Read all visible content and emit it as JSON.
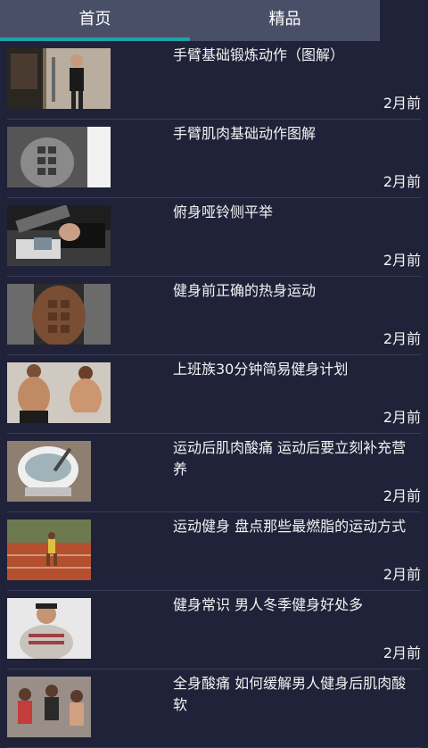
{
  "tabs": [
    {
      "label": "首页",
      "selected": true
    },
    {
      "label": "精品",
      "selected": false
    }
  ],
  "colors": {
    "background": "#1f2238",
    "tabbar": "#4a4f68",
    "indicator": "#1ea3a8"
  },
  "articles": [
    {
      "title": "手臂基础锻炼动作（图解）",
      "time": "2月前",
      "thumb": "man-gym-photo"
    },
    {
      "title": "手臂肌肉基础动作图解",
      "time": "2月前",
      "thumb": "abs-bw-photo"
    },
    {
      "title": "俯身哑铃侧平举",
      "time": "2月前",
      "thumb": "wrist-wrap-photo"
    },
    {
      "title": "健身前正确的热身运动",
      "time": "2月前",
      "thumb": "abs-photo"
    },
    {
      "title": "上班族30分钟简易健身计划",
      "time": "2月前",
      "thumb": "two-men-photo"
    },
    {
      "title": "运动后肌肉酸痛 运动后要立刻补充营养",
      "time": "2月前",
      "thumb": "cup-photo"
    },
    {
      "title": "运动健身 盘点那些最燃脂的运动方式",
      "time": "2月前",
      "thumb": "runner-photo"
    },
    {
      "title": "健身常识 男人冬季健身好处多",
      "time": "2月前",
      "thumb": "man-sweater-photo"
    },
    {
      "title": "全身酸痛 如何缓解男人健身后肌肉酸软",
      "time": "",
      "thumb": "group-photo"
    }
  ]
}
